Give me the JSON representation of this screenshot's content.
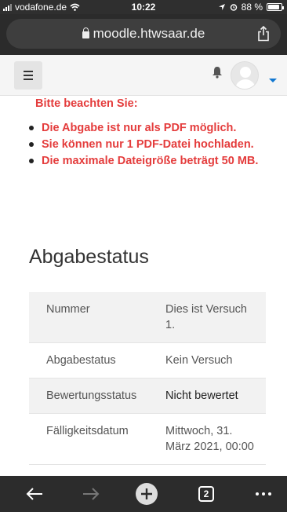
{
  "status_bar": {
    "carrier": "vodafone.de",
    "time": "10:22",
    "battery_text": "88 %",
    "battery_level": 0.88
  },
  "browser": {
    "url": "moodle.htwsaar.de",
    "tab_count": "2"
  },
  "notice": {
    "heading": "Bitte beachten Sie:",
    "items": [
      "Die Abgabe ist nur als PDF möglich.",
      "Sie können nur 1 PDF-Datei hochladen.",
      "Die maximale Dateigröße beträgt 50 MB."
    ]
  },
  "submission": {
    "title": "Abgabestatus",
    "rows": [
      {
        "key": "Nummer",
        "value": "Dies ist Versuch 1."
      },
      {
        "key": "Abgabestatus",
        "value": "Kein Versuch"
      },
      {
        "key": "Bewertungsstatus",
        "value": "Nicht bewertet"
      },
      {
        "key": "Fälligkeitsdatum",
        "value": "Mittwoch, 31. März 2021, 00:00"
      }
    ]
  },
  "colors": {
    "notice_text": "#e43c3c",
    "accent": "#1177d1",
    "chrome_dark": "#2b2b2b"
  },
  "icons": {
    "menu": "hamburger-icon",
    "notifications": "bell-icon",
    "user": "avatar",
    "share": "share-icon",
    "back": "back-arrow-icon",
    "forward": "forward-arrow-icon",
    "new_tab": "plus-icon",
    "tabs": "tabs-icon",
    "more": "more-icon"
  }
}
